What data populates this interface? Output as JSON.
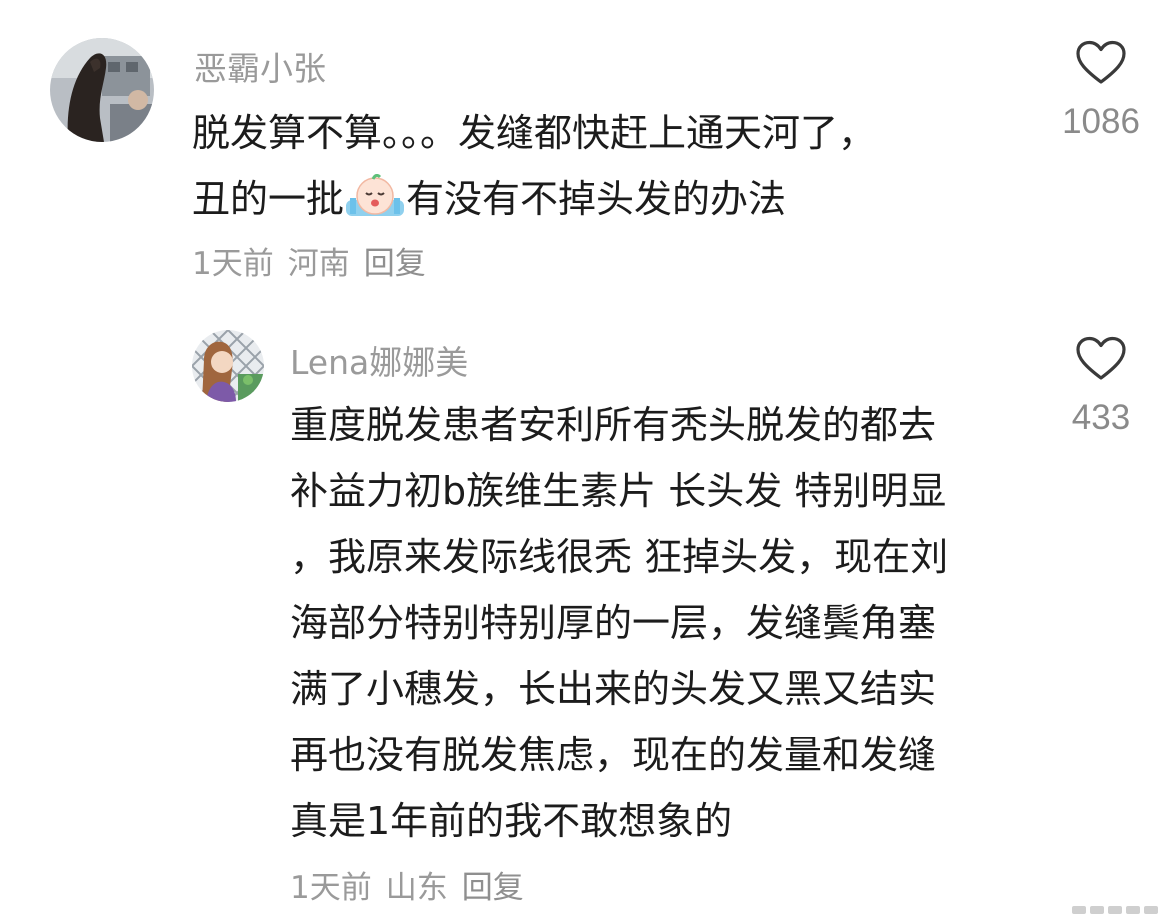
{
  "comments": [
    {
      "username": "恶霸小张",
      "body_lines": [
        "脱发算不算。。。发缝都快赶上通天河了，",
        "丑的一批",
        "有没有不掉头发的办法"
      ],
      "emoji": "crying-face-emoji",
      "time": "1天前",
      "location": "河南",
      "reply_label": "回复",
      "likes": "1086",
      "like_icon": "heart-outline-icon"
    },
    {
      "username": "Lena娜娜美",
      "body_lines": [
        "重度脱发患者安利所有秃头脱发的都去",
        "补益力初b族维生素片  长头发  特别明显",
        "，我原来发际线很秃  狂掉头发，现在刘",
        "海部分特别特别厚的一层，发缝鬓角塞",
        "满了小穗发，长出来的头发又黑又结实",
        "再也没有脱发焦虑，现在的发量和发缝",
        "真是1年前的我不敢想象的"
      ],
      "time": "1天前",
      "location": "山东",
      "reply_label": "回复",
      "likes": "433",
      "like_icon": "heart-outline-icon"
    }
  ]
}
